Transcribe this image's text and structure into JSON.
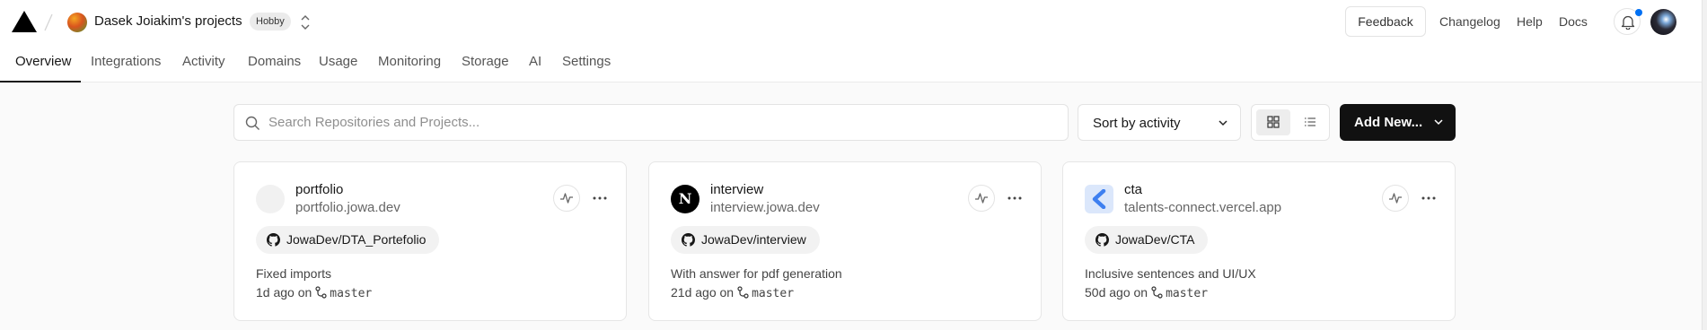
{
  "header": {
    "team_name": "Dasek Joiakim's projects",
    "plan_badge": "Hobby",
    "feedback_label": "Feedback",
    "links": [
      "Changelog",
      "Help",
      "Docs"
    ]
  },
  "tabs": [
    "Overview",
    "Integrations",
    "Activity",
    "Domains",
    "Usage",
    "Monitoring",
    "Storage",
    "AI",
    "Settings"
  ],
  "active_tab": "Overview",
  "toolbar": {
    "search_placeholder": "Search Repositories and Projects...",
    "sort_label": "Sort by activity",
    "view_mode": "grid",
    "add_new_label": "Add New..."
  },
  "projects": [
    {
      "name": "portfolio",
      "url": "portfolio.jowa.dev",
      "icon": "blank-circle-icon",
      "repo": "JowaDev/DTA_Portefolio",
      "commit_message": "Fixed imports",
      "age": "1d ago on",
      "branch": "master"
    },
    {
      "name": "interview",
      "url": "interview.jowa.dev",
      "icon": "nextjs-icon",
      "icon_letter": "N",
      "repo": "JowaDev/interview",
      "commit_message": "With answer for pdf generation",
      "age": "21d ago on",
      "branch": "master"
    },
    {
      "name": "cta",
      "url": "talents-connect.vercel.app",
      "icon": "cta-logo-icon",
      "repo": "JowaDev/CTA",
      "commit_message": "Inclusive sentences and UI/UX",
      "age": "50d ago on",
      "branch": "master"
    }
  ],
  "colors": {
    "accent": "#171717",
    "notification_dot": "#0070f3",
    "page_background": "#fafafa"
  }
}
